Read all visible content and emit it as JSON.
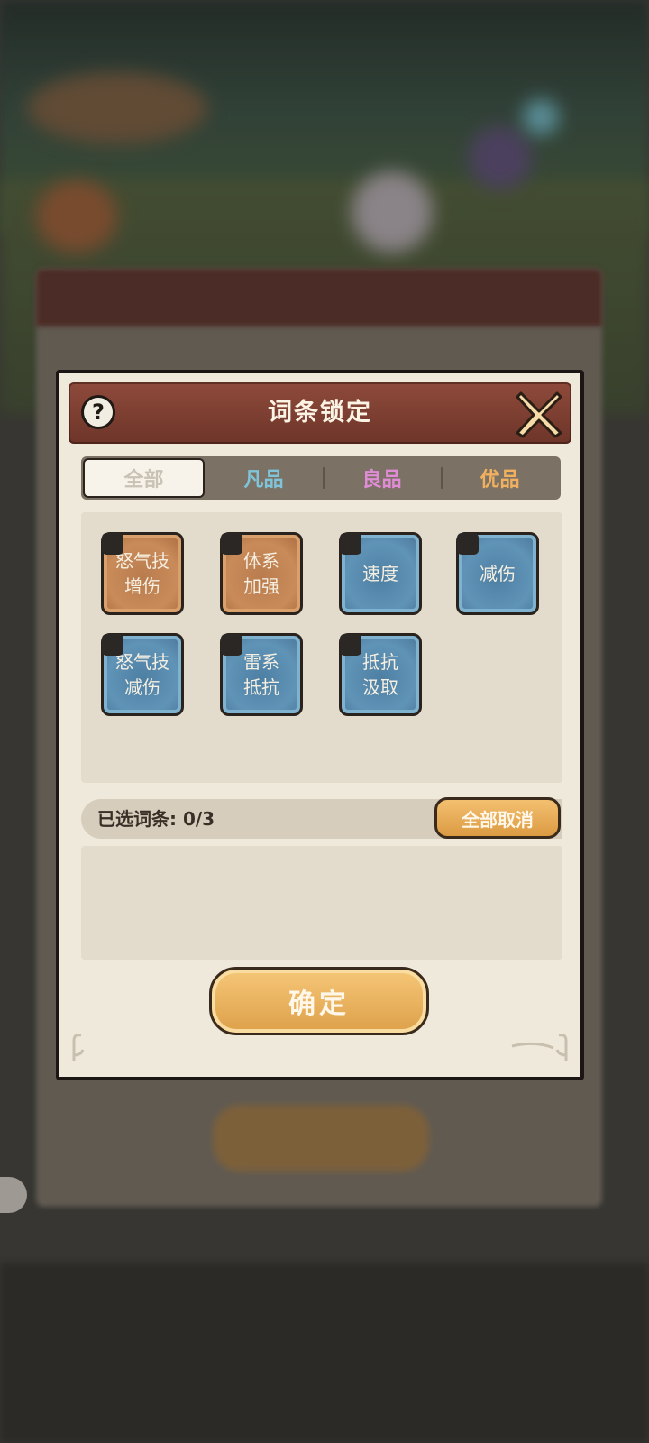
{
  "dialog": {
    "title": "词条锁定",
    "tabs": [
      {
        "label": "全部",
        "color": "#c9c2b4",
        "active": true
      },
      {
        "label": "凡品",
        "color": "#7fc4d8",
        "active": false
      },
      {
        "label": "良品",
        "color": "#e08bd6",
        "active": false
      },
      {
        "label": "优品",
        "color": "#f0b060",
        "active": false
      }
    ],
    "chips": [
      {
        "label": "怒气技\n增伤",
        "tier": "orange"
      },
      {
        "label": "体系\n加强",
        "tier": "orange"
      },
      {
        "label": "速度",
        "tier": "blue"
      },
      {
        "label": "减伤",
        "tier": "blue"
      },
      {
        "label": "怒气技\n减伤",
        "tier": "blue"
      },
      {
        "label": "雷系\n抵抗",
        "tier": "blue"
      },
      {
        "label": "抵抗\n汲取",
        "tier": "blue"
      }
    ],
    "selected_label": "已选词条: 0/3",
    "cancel_all_label": "全部取消",
    "confirm_label": "确定"
  },
  "icons": {
    "help": "question-icon",
    "close": "close-icon"
  }
}
